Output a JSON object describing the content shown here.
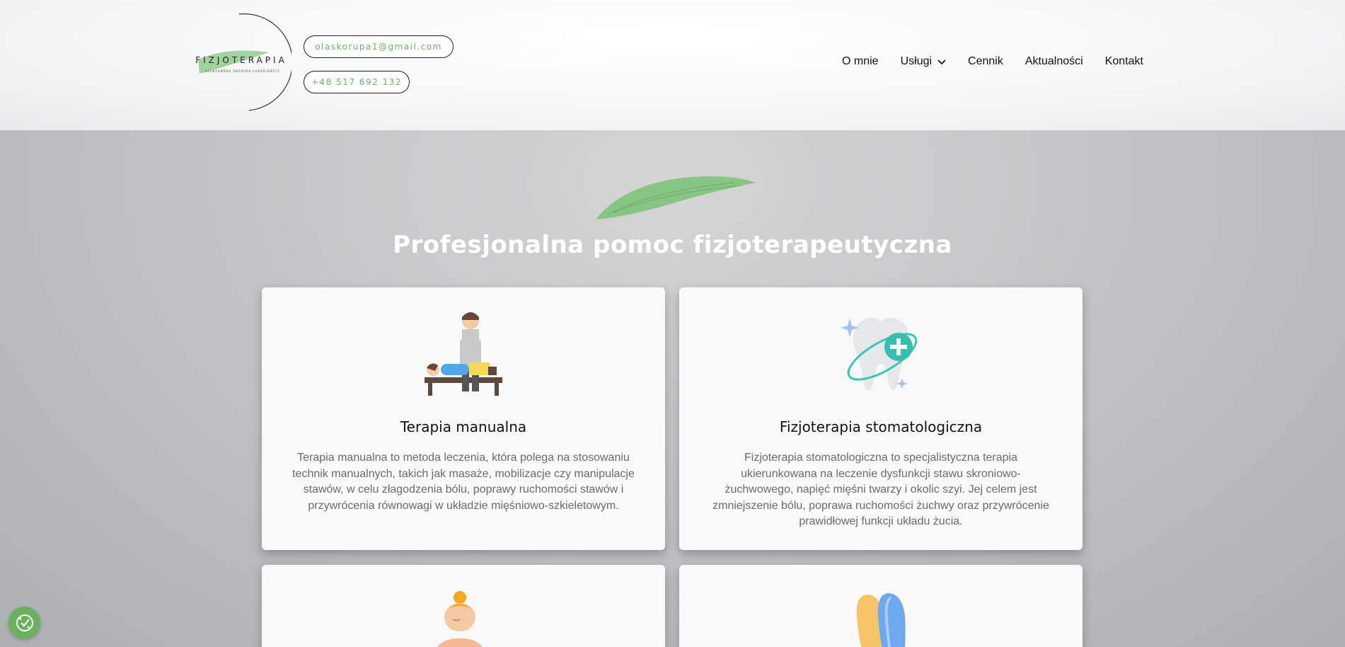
{
  "logo": {
    "title": "FIZJOTERAPIA",
    "subtitle": "ALEKSANDRA SKORUPA-ŁUKASIEWICZ"
  },
  "contact": {
    "email": "olaskorupa1@gmail.com",
    "phone": "+48 517 692 132"
  },
  "nav": {
    "items": [
      {
        "label": "O mnie"
      },
      {
        "label": "Usługi"
      },
      {
        "label": "Cennik"
      },
      {
        "label": "Aktualności"
      },
      {
        "label": "Kontakt"
      }
    ]
  },
  "hero": {
    "title": "Profesjonalna pomoc fizjoterapeutyczna"
  },
  "cards": [
    {
      "icon": "therapist-icon",
      "title": "Terapia manualna",
      "text": "Terapia manualna to metoda leczenia, która polega na stosowaniu technik manualnych, takich jak masaże, mobilizacje czy manipulacje stawów, w celu złagodzenia bólu, poprawy ruchomości stawów i przywrócenia równowagi w układzie mięśniowo-szkieletowym."
    },
    {
      "icon": "tooth-icon",
      "title": "Fizjoterapia stomatologiczna",
      "text": "Fizjoterapia stomatologiczna to specjalistyczna terapia ukierunkowana na leczenie dysfunkcji stawu skroniowo-żuchwowego, napięć mięśni twarzy i okolic szyi. Jej celem jest zmniejszenie bólu, poprawa ruchomości żuchwy oraz przywrócenie prawidłowej funkcji układu żucia."
    },
    {
      "icon": "massage-person-icon"
    },
    {
      "icon": "insoles-icon"
    }
  ],
  "colors": {
    "accent_green": "#6fb169",
    "cookie_green": "#6ab15b"
  }
}
